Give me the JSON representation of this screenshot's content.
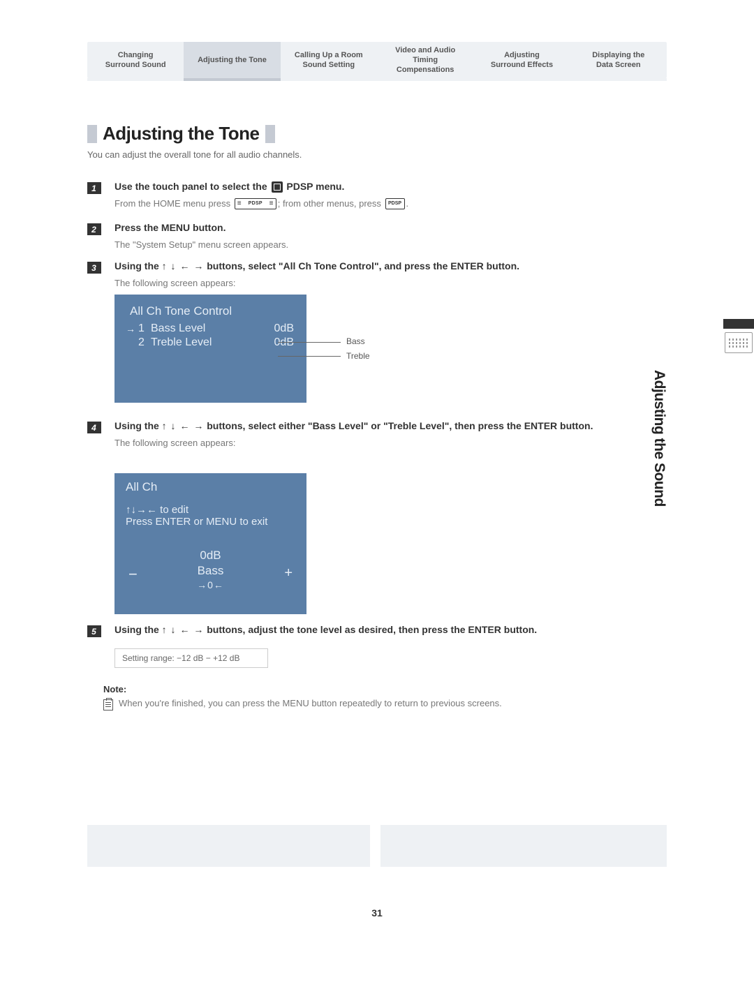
{
  "tabs": [
    {
      "line1": "Changing",
      "line2": "Surround Sound"
    },
    {
      "line1": "Adjusting the Tone",
      "line2": ""
    },
    {
      "line1": "Calling Up a Room",
      "line2": "Sound Setting"
    },
    {
      "line1": "Video and Audio",
      "line2": "Timing",
      "line3": "Compensations"
    },
    {
      "line1": "Adjusting",
      "line2": "Surround Effects"
    },
    {
      "line1": "Displaying the",
      "line2": "Data Screen"
    }
  ],
  "title": "Adjusting the Tone",
  "intro": "You can adjust the overall tone for all audio channels.",
  "steps": {
    "s1": {
      "num": "1",
      "head_a": "Use the touch panel to select the ",
      "head_b": " PDSP menu.",
      "sub_a": "From the HOME menu press ",
      "sub_b": "; from other menus, press ",
      "sub_c": ".",
      "pdsp_long": "PDSP",
      "pdsp_short": "PDSP"
    },
    "s2": {
      "num": "2",
      "head": "Press the MENU button.",
      "sub": "The \"System Setup\" menu screen appears."
    },
    "s3": {
      "num": "3",
      "head_a": "Using the ",
      "arrows": "↑ ↓ ← →",
      "head_b": " buttons, select \"All Ch Tone Control\", and press the ENTER button.",
      "sub": "The following screen appears:"
    },
    "s4": {
      "num": "4",
      "head_a": "Using the ",
      "arrows": "↑ ↓ ← →",
      "head_b": " buttons, select either \"Bass Level\" or \"Treble Level\", then press the ENTER button.",
      "sub": "The following screen appears:"
    },
    "s5": {
      "num": "5",
      "head_a": "Using the ",
      "arrows": "↑ ↓ ← →",
      "head_b": " buttons, adjust the tone level as desired, then press the ENTER button."
    }
  },
  "screen1": {
    "title": "All Ch Tone Control",
    "rows": [
      {
        "arrow": "→",
        "idx": "1",
        "name": "Bass Level",
        "val": "0dB",
        "callout": "Bass"
      },
      {
        "arrow": "",
        "idx": "2",
        "name": "Treble Level",
        "val": "0dB",
        "callout": "Treble"
      }
    ]
  },
  "screen2": {
    "title": "All Ch",
    "line1": "↑↓→← to edit",
    "line2": "Press ENTER or MENU to exit",
    "value": "0dB",
    "param": "Bass",
    "indicator": "→0←",
    "minus": "−",
    "plus": "+"
  },
  "range": "Setting range: −12 dB − +12 dB",
  "note_head": "Note:",
  "note_text": "When you're finished, you can press the MENU button repeatedly to return to previous screens.",
  "side_label": "Adjusting the Sound",
  "page_number": "31"
}
